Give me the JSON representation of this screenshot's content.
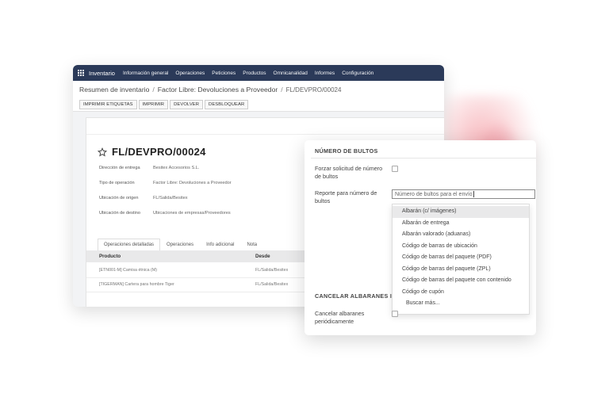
{
  "topbar": {
    "brand": "Inventario",
    "menu": [
      "Información general",
      "Operaciones",
      "Peticiones",
      "Productos",
      "Omnicanalidad",
      "Informes",
      "Configuración"
    ]
  },
  "breadcrumb": {
    "first": "Resumen de inventario",
    "second": "Factor Libre: Devoluciones a Proveedor",
    "current": "FL/DEVPRO/00024"
  },
  "actions": [
    "IMPRIMIR ETIQUETAS",
    "IMPRIMIR",
    "DEVOLVER",
    "DESBLOQUEAR"
  ],
  "record": {
    "title": "FL/DEVPRO/00024",
    "fields": [
      {
        "label": "Dirección de entrega",
        "value": "Besitex Accesorios S.L."
      },
      {
        "label": "Tipo de operación",
        "value": "Factor Libre: Devoluciones a Proveedor"
      },
      {
        "label": "Ubicación de origen",
        "value": "FL/Salida/Besitex"
      },
      {
        "label": "Ubicación de destino",
        "value": "Ubicaciones de empresas/Proveedores"
      }
    ]
  },
  "tabs": [
    "Operaciones detalladas",
    "Operaciones",
    "Info adicional",
    "Nota"
  ],
  "table": {
    "headers": [
      "Producto",
      "Desde"
    ],
    "rows": [
      [
        "[ETN001-M] Camisa étnica (M)",
        "FL/Salida/Besitex"
      ],
      [
        "[TIGERMAN] Cartera para hombre Tiger",
        "FL/Salida/Besitex"
      ]
    ]
  },
  "panel": {
    "section1": "NÚMERO DE BULTOS",
    "force_label": "Forzar solicitud de número de bultos",
    "report_label": "Reporte para número de bultos",
    "search_value": "Número de bultos para el envío",
    "options": [
      "Albarán (c/ imágenes)",
      "Albarán de entrega",
      "Albarán valorado (aduanas)",
      "Código de barras de ubicación",
      "Código de barras del paquete (PDF)",
      "Código de barras del paquete (ZPL)",
      "Código de barras del paquete con contenido",
      "Código de cupón"
    ],
    "search_more": "Buscar más...",
    "section2": "CANCELAR ALBARANES I",
    "cancel_label": "Cancelar albaranes periódicamente"
  }
}
